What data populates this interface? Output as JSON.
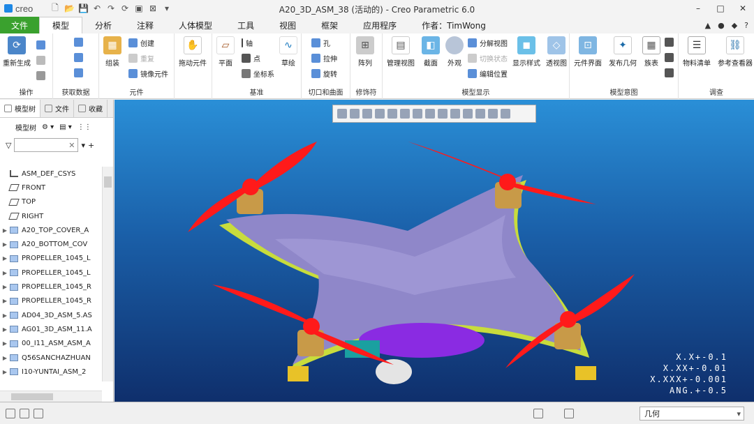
{
  "app": {
    "brand": "creo",
    "title": "A20_3D_ASM_38 (活动的) - Creo Parametric 6.0"
  },
  "window": {
    "minimize": "–",
    "maximize": "□",
    "close": "✕"
  },
  "tabs": [
    "文件",
    "模型",
    "分析",
    "注释",
    "人体模型",
    "工具",
    "视图",
    "框架",
    "应用程序",
    "作者：TimWong"
  ],
  "ribbon": {
    "regenerate": "重新生成",
    "operations": "操作",
    "get_data": "获取数据",
    "assemble": "组装",
    "create": "创建",
    "repeat": "重复",
    "mirror": "镜像元件",
    "components": "元件",
    "drag": "拖动元件",
    "plane": "平面",
    "axis": "轴",
    "point": "点",
    "csys": "坐标系",
    "sketch": "草绘",
    "datum": "基准",
    "hole": "孔",
    "extrude": "拉伸",
    "revolve": "旋转",
    "cut_surface": "切口和曲面",
    "pattern": "阵列",
    "modifiers": "修饰符",
    "manage_views": "管理视图",
    "section": "截面",
    "appearance": "外观",
    "explode": "分解视图",
    "toggle_status": "切换状态",
    "edit_position": "编辑位置",
    "display_style": "显示样式",
    "perspective": "透视图",
    "model_display": "模型显示",
    "component_interface": "元件界面",
    "publish_geometry": "发布几何",
    "family_table": "族表",
    "model_intent": "模型意图",
    "bom": "物料清单",
    "ref_viewer": "参考查看器",
    "investigate": "调查"
  },
  "left": {
    "tabs": [
      "模型树",
      "文件",
      "收藏"
    ],
    "tree_label": "模型树",
    "tree": [
      {
        "label": "ASM_DEF_CSYS",
        "kind": "csys",
        "expandable": false
      },
      {
        "label": "FRONT",
        "kind": "plane",
        "expandable": false
      },
      {
        "label": "TOP",
        "kind": "plane",
        "expandable": false
      },
      {
        "label": "RIGHT",
        "kind": "plane",
        "expandable": false
      },
      {
        "label": "A20_TOP_COVER_A",
        "kind": "part",
        "expandable": true
      },
      {
        "label": "A20_BOTTOM_COV",
        "kind": "part",
        "expandable": true
      },
      {
        "label": "PROPELLER_1045_L",
        "kind": "part",
        "expandable": true
      },
      {
        "label": "PROPELLER_1045_L",
        "kind": "part",
        "expandable": true
      },
      {
        "label": "PROPELLER_1045_R",
        "kind": "part",
        "expandable": true
      },
      {
        "label": "PROPELLER_1045_R",
        "kind": "part",
        "expandable": true
      },
      {
        "label": "AD04_3D_ASM_5.AS",
        "kind": "part",
        "expandable": true
      },
      {
        "label": "AG01_3D_ASM_11.A",
        "kind": "part",
        "expandable": true
      },
      {
        "label": "00_I11_ASM_ASM_A",
        "kind": "part",
        "expandable": true
      },
      {
        "label": "Q56SANCHAZHUAN",
        "kind": "part",
        "expandable": true
      },
      {
        "label": "I10-YUNTAI_ASM_2",
        "kind": "part",
        "expandable": true
      }
    ]
  },
  "viewport": {
    "tolerances": [
      "X.X+-0.1",
      "X.XX+-0.01",
      "X.XXX+-0.001",
      "ANG.+-0.5"
    ]
  },
  "status": {
    "filter": "几何"
  },
  "colors": {
    "file_tab": "#3aa12e",
    "bg_top": "#2a8fd7",
    "bg_bottom": "#0f2f6c",
    "propeller": "#ff1a1a",
    "body": "#8f87c9"
  }
}
